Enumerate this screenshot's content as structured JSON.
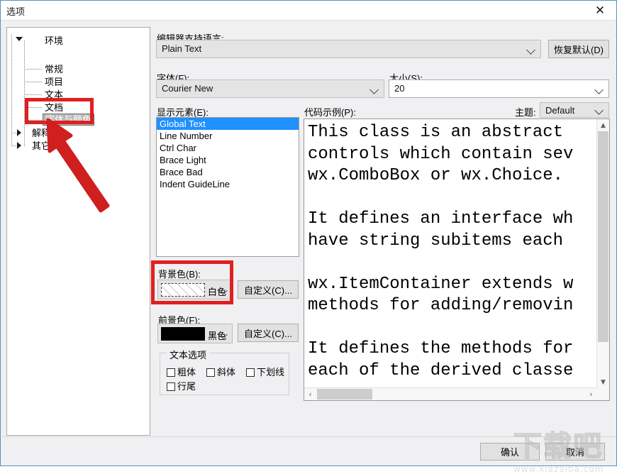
{
  "window": {
    "title": "选项",
    "close_icon": "close-icon"
  },
  "sidebar": {
    "items": [
      {
        "label": "环境",
        "state": "expanded",
        "depth": 0
      },
      {
        "label": "常规",
        "state": "leaf",
        "depth": 1
      },
      {
        "label": "项目",
        "state": "leaf",
        "depth": 1
      },
      {
        "label": "文本",
        "state": "leaf",
        "depth": 1
      },
      {
        "label": "文档",
        "state": "leaf",
        "depth": 1
      },
      {
        "label": "字体与颜色",
        "state": "leaf-selected",
        "depth": 1
      },
      {
        "label": "解释器",
        "state": "collapsed",
        "depth": 0
      },
      {
        "label": "其它",
        "state": "collapsed",
        "depth": 0
      }
    ]
  },
  "main": {
    "language_label": "编辑器支持语言:",
    "language_value": "Plain Text",
    "restore_default_button": "恢复默认(D)",
    "font_label": "字体(F):",
    "font_value": "Courier New",
    "size_label": "大小(S):",
    "size_value": "20",
    "display_elements_label": "显示元素(E):",
    "display_elements": [
      "Global Text",
      "Line Number",
      "Ctrl Char",
      "Brace Light",
      "Brace Bad",
      "Indent GuideLine"
    ],
    "display_elements_selected_index": 0,
    "code_sample_label": "代码示例(P):",
    "theme_label": "主题:",
    "theme_value": "Default",
    "code_sample_text": "This class is an abstract\ncontrols which contain sev\nwx.ComboBox or wx.Choice.\n\nIt defines an interface wh\nhave string subitems each\n\nwx.ItemContainer extends w\nmethods for adding/removin\n\nIt defines the methods for\neach of the derived classe",
    "background_color_label": "背景色(B):",
    "background_color_value": "白色",
    "background_color_hex": "#ffffff",
    "background_customize_button": "自定义(C)...",
    "foreground_color_label": "前景色(F):",
    "foreground_color_value": "黑色",
    "foreground_color_hex": "#000000",
    "foreground_customize_button": "自定义(C)...",
    "text_options_title": "文本选项",
    "text_options": [
      {
        "label": "粗体",
        "checked": false
      },
      {
        "label": "斜体",
        "checked": false
      },
      {
        "label": "下划线",
        "checked": false
      },
      {
        "label": "行尾",
        "checked": false
      }
    ]
  },
  "footer": {
    "ok_button": "确认",
    "cancel_button": "取消"
  },
  "watermark": {
    "logo_text": "下载吧",
    "site_text": "www.xiazaiba.com"
  },
  "annotations": {
    "highlight_color": "#e02020",
    "boxes": [
      "sidebar-font-and-color-item",
      "background-color-field"
    ],
    "arrow": "red-arrow-pointing-to-font-and-color"
  }
}
